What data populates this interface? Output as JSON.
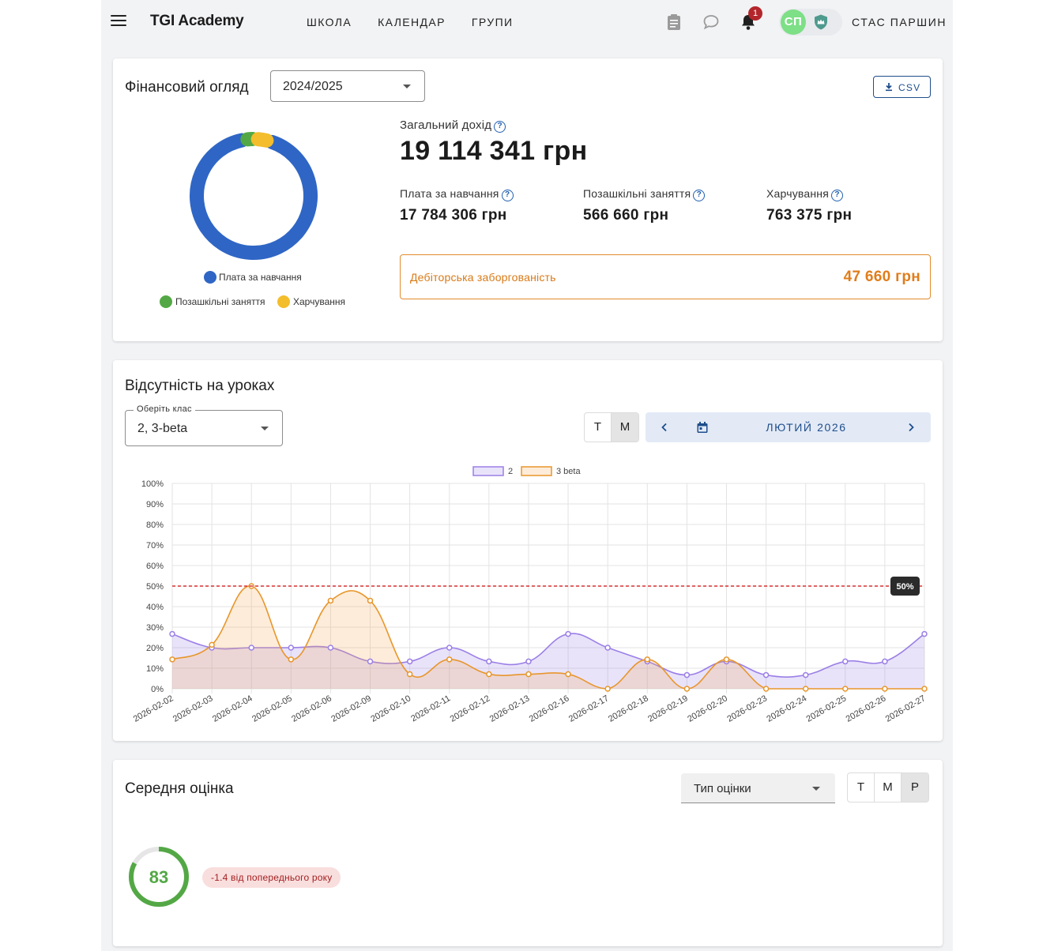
{
  "header": {
    "brand": "TGI Academy",
    "nav": [
      "ШКОЛА",
      "КАЛЕНДАР",
      "ГРУПИ"
    ],
    "notifications_count": "1",
    "avatar_initials": "СП",
    "user_name": "СТАС ПАРШИН",
    "icons": [
      "menu-icon",
      "clipboard-icon",
      "chat-icon",
      "bell-icon",
      "shield-crown-icon"
    ]
  },
  "finance": {
    "title": "Фінансовий огляд",
    "year": "2024/2025",
    "csv_label": "CSV",
    "total_label": "Загальний дохід",
    "total_value": "19 114 341 грн",
    "items": [
      {
        "label": "Плата за навчання",
        "value": "17 784 306 грн",
        "color": "#2f66c5"
      },
      {
        "label": "Позашкільні заняття",
        "value": "566 660 грн",
        "color": "#53a845"
      },
      {
        "label": "Харчування",
        "value": "763 375 грн",
        "color": "#f3bd2b"
      }
    ],
    "debt_label": "Дебіторська заборгованість",
    "debt_value": "47 660 грн",
    "debt_color": "#e07d1b"
  },
  "attendance": {
    "title": "Відсутність на уроках",
    "class_select_label": "Оберіть клас",
    "class_select_value": "2, 3-beta",
    "view_toggle": [
      "Т",
      "М"
    ],
    "view_active": "М",
    "month_label": "ЛЮТИЙ 2026",
    "threshold_label": "50%",
    "chart_data": {
      "type": "line",
      "x": [
        "2026-02-02",
        "2026-02-03",
        "2026-02-04",
        "2026-02-05",
        "2026-02-06",
        "2026-02-09",
        "2026-02-10",
        "2026-02-11",
        "2026-02-12",
        "2026-02-13",
        "2026-02-16",
        "2026-02-17",
        "2026-02-18",
        "2026-02-19",
        "2026-02-20",
        "2026-02-23",
        "2026-02-24",
        "2026-02-25",
        "2026-02-26",
        "2026-02-27"
      ],
      "ylim": [
        0,
        100
      ],
      "y_ticks": [
        "0%",
        "10%",
        "20%",
        "30%",
        "40%",
        "50%",
        "60%",
        "70%",
        "80%",
        "90%",
        "100%"
      ],
      "threshold": 50,
      "grid": true,
      "legend_position": "top-center",
      "series": [
        {
          "name": "2",
          "color": "#9b7fe6",
          "fill": "rgba(155,127,230,0.22)",
          "values": [
            26.7,
            20,
            20,
            20,
            20,
            13.3,
            13.3,
            20,
            13.3,
            13.3,
            26.7,
            20,
            13.3,
            6.7,
            13.3,
            6.7,
            6.7,
            13.3,
            13.3,
            26.7
          ]
        },
        {
          "name": "3 beta",
          "color": "#e8962b",
          "fill": "rgba(245,170,80,0.22)",
          "values": [
            14.3,
            21.4,
            50,
            14.3,
            42.9,
            42.9,
            7.1,
            14.3,
            7.1,
            7.1,
            7.1,
            0,
            14.3,
            0,
            14.3,
            0,
            0,
            0,
            0,
            0
          ]
        }
      ]
    }
  },
  "grades": {
    "title": "Середня оцінка",
    "type_select": "Тип оцінки",
    "view_toggle": [
      "Т",
      "М",
      "Р"
    ],
    "view_active": "Р",
    "average": "83",
    "average_fraction": 0.83,
    "ring_color": "#53a845",
    "change_text": "-1.4 від попереднього року"
  }
}
